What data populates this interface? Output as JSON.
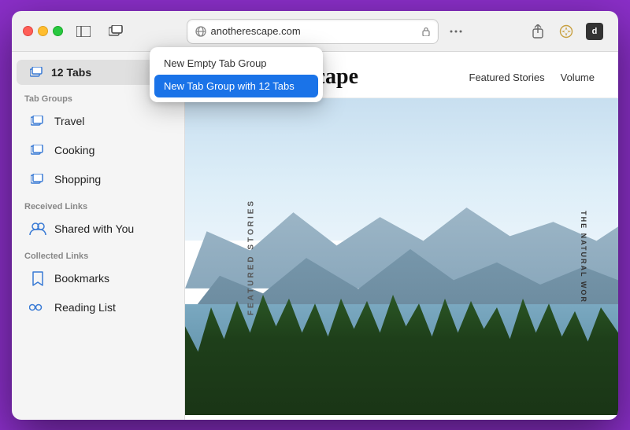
{
  "window": {
    "title": "Another Escape"
  },
  "titlebar": {
    "address": "anotherescape.com",
    "address_icon": "globe",
    "lock_icon": "lock"
  },
  "popup": {
    "items": [
      {
        "label": "New Empty Tab Group",
        "active": false
      },
      {
        "label": "New Tab Group with 12 Tabs",
        "active": true
      }
    ]
  },
  "sidebar": {
    "tabs_label": "12 Tabs",
    "sections": [
      {
        "header": "Tab Groups",
        "items": [
          {
            "label": "Travel",
            "icon": "tab-group-icon"
          },
          {
            "label": "Cooking",
            "icon": "tab-group-icon"
          },
          {
            "label": "Shopping",
            "icon": "tab-group-icon"
          }
        ]
      },
      {
        "header": "Received Links",
        "items": [
          {
            "label": "Shared with You",
            "icon": "shared-icon"
          }
        ]
      },
      {
        "header": "Collected Links",
        "items": [
          {
            "label": "Bookmarks",
            "icon": "bookmark-icon"
          },
          {
            "label": "Reading List",
            "icon": "reading-list-icon"
          }
        ]
      }
    ]
  },
  "webcontent": {
    "site_title": "Another Escape",
    "nav_links": [
      "Featured Stories",
      "Volume"
    ],
    "vertical_text_left": "Featured Stories",
    "vertical_text_right": "The Natural Wor"
  }
}
